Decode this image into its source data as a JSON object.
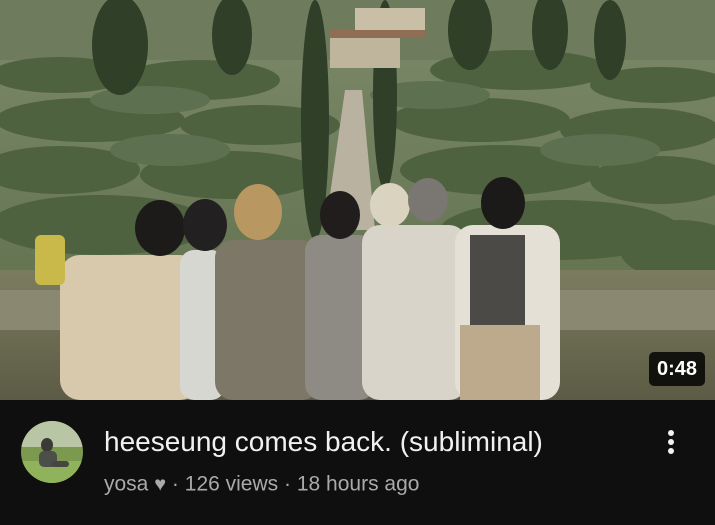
{
  "video": {
    "duration": "0:48",
    "title": "heeseung comes back. (subliminal)",
    "channel": "yosa",
    "channel_badge": "♥",
    "separator": "·",
    "views": "126 views",
    "age": "18 hours ago"
  },
  "icons": {
    "more": "more-vert-icon",
    "badge": "heart-icon"
  }
}
